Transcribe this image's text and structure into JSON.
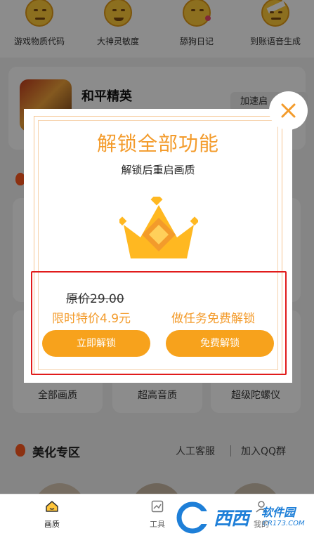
{
  "emoji_row": {
    "items": [
      {
        "label": "游戏物质代码"
      },
      {
        "label": "大神灵敏度"
      },
      {
        "label": "舔狗日记"
      },
      {
        "label": "到账语音生成"
      }
    ]
  },
  "game_card": {
    "title": "和平精英",
    "speed_button": "加速启"
  },
  "tiles": {
    "row_labels": [
      "全部画质",
      "超高音质",
      "超级陀螺仪"
    ]
  },
  "beauty_section": {
    "title": "美化专区",
    "customer_service": "人工客服",
    "join_qq": "加入QQ群"
  },
  "modal": {
    "title": "解锁全部功能",
    "subtitle": "解锁后重启画质",
    "original_price": "原价29.00",
    "sale_price": "限时特价4.9元",
    "task_unlock_text": "做任务免费解锁",
    "buy_button": "立即解锁",
    "free_button": "免费解锁"
  },
  "bottom_nav": {
    "items": [
      {
        "label": "画质",
        "active": true
      },
      {
        "label": "工具",
        "active": false
      },
      {
        "label": "我的",
        "active": false
      }
    ]
  },
  "watermark": {
    "brand": "西西",
    "sub": "软件园",
    "url": "CR173.COM"
  },
  "colors": {
    "accent": "#f39b2b",
    "button": "#f7a21c",
    "annotation": "#e11b1b"
  }
}
